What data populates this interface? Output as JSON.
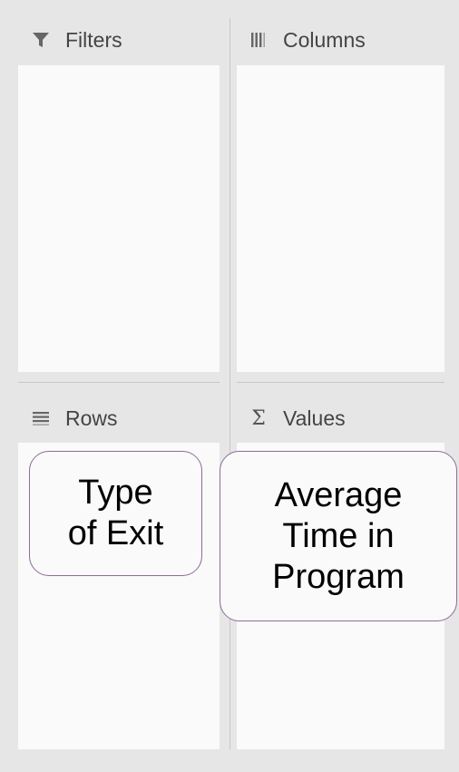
{
  "panels": {
    "filters": {
      "label": "Filters",
      "icon": "filter-icon"
    },
    "columns": {
      "label": "Columns",
      "icon": "columns-icon"
    },
    "rows": {
      "label": "Rows",
      "icon": "rows-icon"
    },
    "values": {
      "label": "Values",
      "icon": "sigma-icon",
      "icon_glyph": "Σ"
    }
  },
  "callouts": {
    "rows": "Type\nof Exit",
    "values": "Average\nTime in\nProgram"
  },
  "colors": {
    "background": "#e6e6e6",
    "drop_area": "#fafafa",
    "callout_border": "#8f6a9a"
  }
}
